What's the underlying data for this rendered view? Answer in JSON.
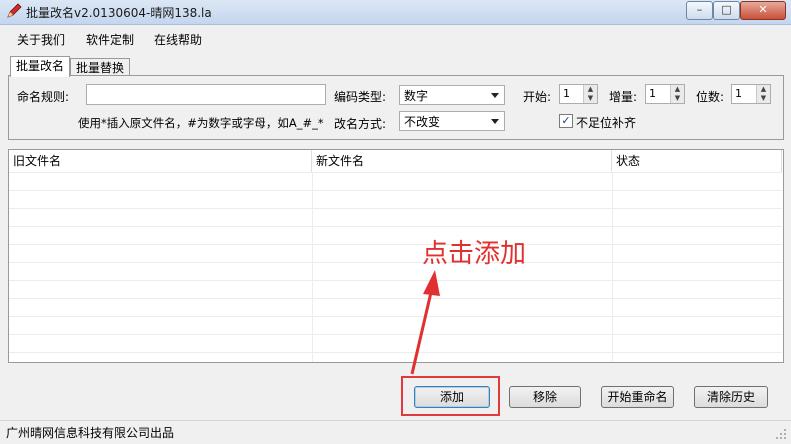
{
  "window": {
    "title": "批量改名v2.0130604-晴网138.la",
    "minimize": "–",
    "maximize": "□",
    "close": "✕"
  },
  "menu": [
    "关于我们",
    "软件定制",
    "在线帮助"
  ],
  "tabs": [
    "批量改名",
    "批量替换"
  ],
  "form": {
    "naming_rule_label": "命名规则:",
    "naming_rule_value": "",
    "encoding_type_label": "编码类型:",
    "encoding_type_value": "数字",
    "start_label": "开始:",
    "start_value": "1",
    "increment_label": "增量:",
    "increment_value": "1",
    "digits_label": "位数:",
    "digits_value": "1",
    "hint": "使用*插入原文件名，#为数字或字母，如A_#_*",
    "rename_mode_label": "改名方式:",
    "rename_mode_value": "不改变",
    "pad_label": "不足位补齐",
    "pad_checked": true
  },
  "table": {
    "columns": [
      "旧文件名",
      "新文件名",
      "状态"
    ],
    "rows": []
  },
  "buttons": {
    "add": "添加",
    "remove": "移除",
    "start": "开始重命名",
    "clear_history": "清除历史"
  },
  "annotation": {
    "text": "点击添加",
    "color": "#e03030"
  },
  "status": "广州晴网信息科技有限公司出品"
}
